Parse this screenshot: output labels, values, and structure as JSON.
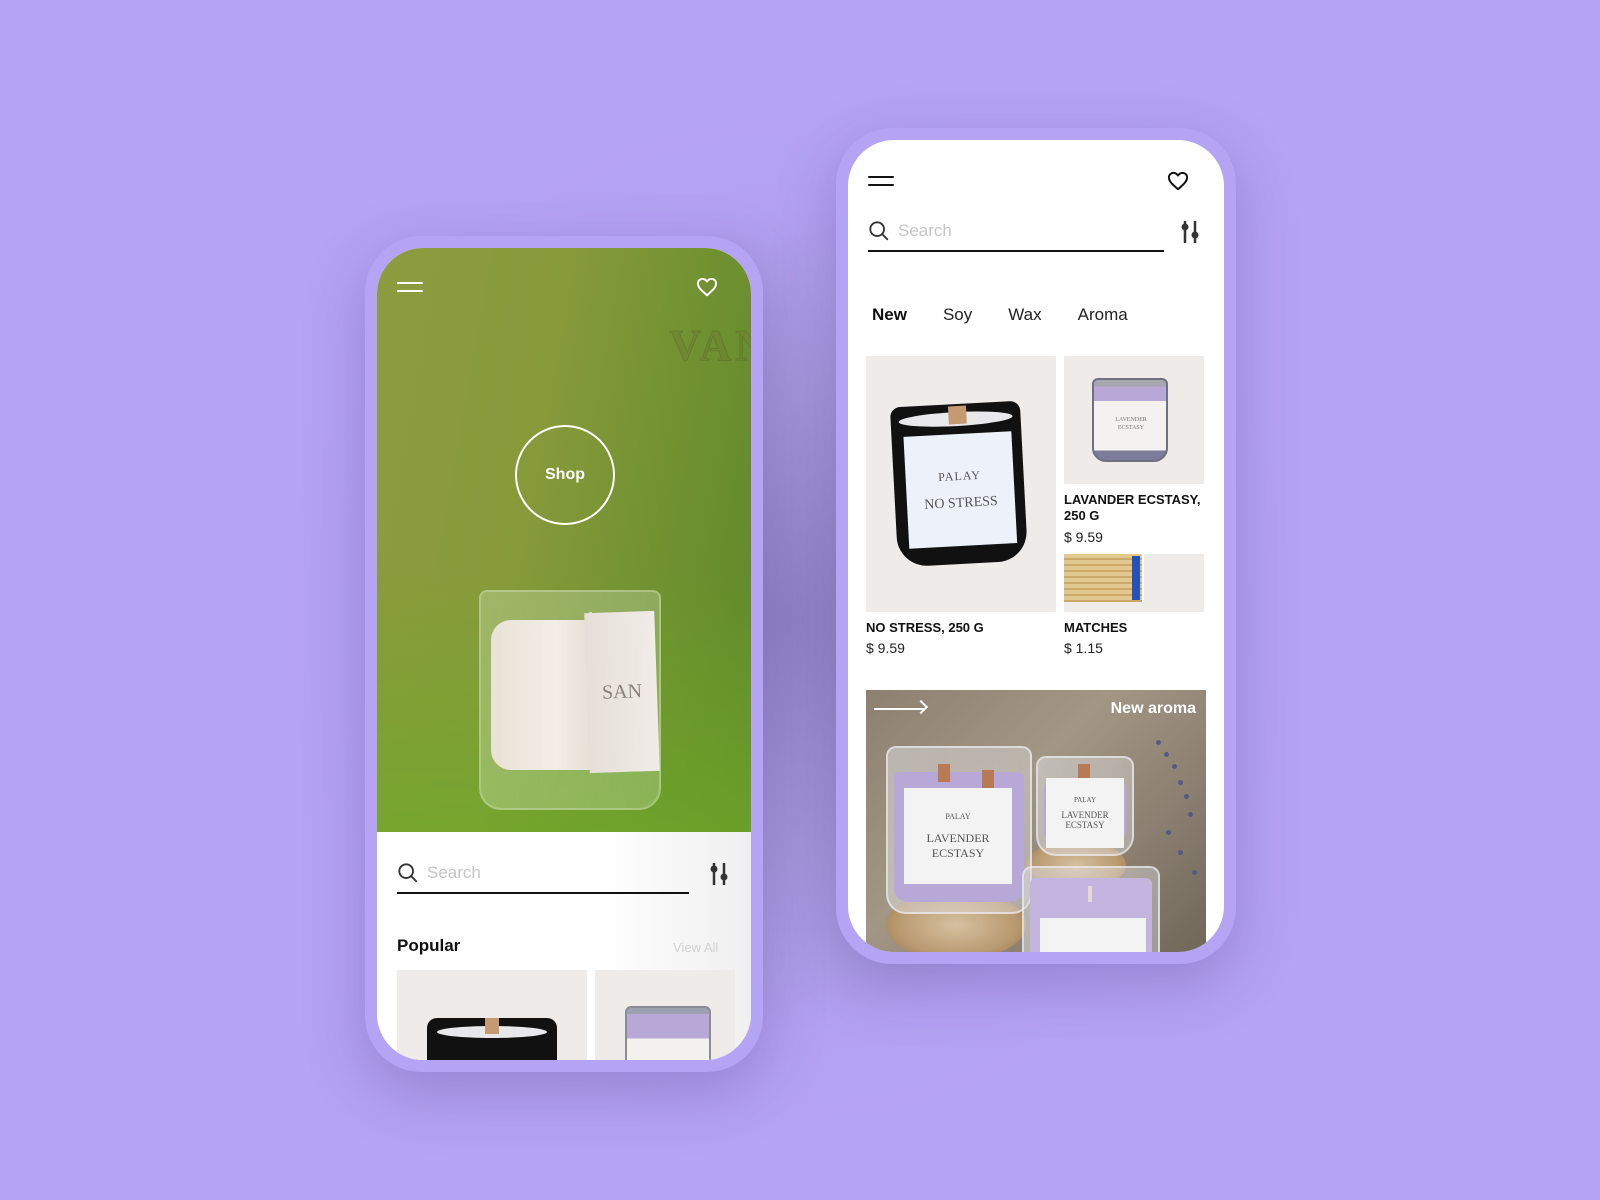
{
  "colors": {
    "background": "#b5a3f3",
    "phone_frame": "#b5a3f3",
    "hero_green": "#87993a",
    "text_dark": "#111111",
    "placeholder": "#c7c4c4",
    "thumb_bg": "#efebe9"
  },
  "left_phone": {
    "header": {
      "menu_icon": "hamburger-menu-icon",
      "favorites_icon": "heart-icon"
    },
    "hero": {
      "background_word": "VAN",
      "shop_button_label": "Shop",
      "candle_label_text": "SAN"
    },
    "search": {
      "icon": "search-icon",
      "placeholder": "Search",
      "value": "",
      "filter_icon": "filter-sliders-icon"
    },
    "popular": {
      "title": "Popular",
      "view_all_label": "View All"
    }
  },
  "right_phone": {
    "header": {
      "menu_icon": "hamburger-menu-icon",
      "favorites_icon": "heart-icon"
    },
    "search": {
      "icon": "search-icon",
      "placeholder": "Search",
      "value": "",
      "filter_icon": "filter-sliders-icon"
    },
    "tabs": [
      {
        "label": "New",
        "active": true
      },
      {
        "label": "Soy",
        "active": false
      },
      {
        "label": "Wax",
        "active": false
      },
      {
        "label": "Aroma",
        "active": false
      }
    ],
    "products": [
      {
        "name": "NO STRESS, 250 G",
        "price": "$ 9.59",
        "brand": "PALAY",
        "label": "NO STRESS"
      },
      {
        "name": "LAVANDER ECSTASY, 250 G",
        "price": "$ 9.59",
        "brand": "PALAY",
        "label": "LAVENDER ECSTASY"
      },
      {
        "name": "MATCHES",
        "price": "$ 1.15"
      }
    ],
    "banner": {
      "title": "New aroma",
      "arrow_icon": "arrow-right-icon",
      "jar_brand": "PALAY",
      "jar_label_line1": "LAVENDER",
      "jar_label_line2": "ECSTASY"
    }
  }
}
